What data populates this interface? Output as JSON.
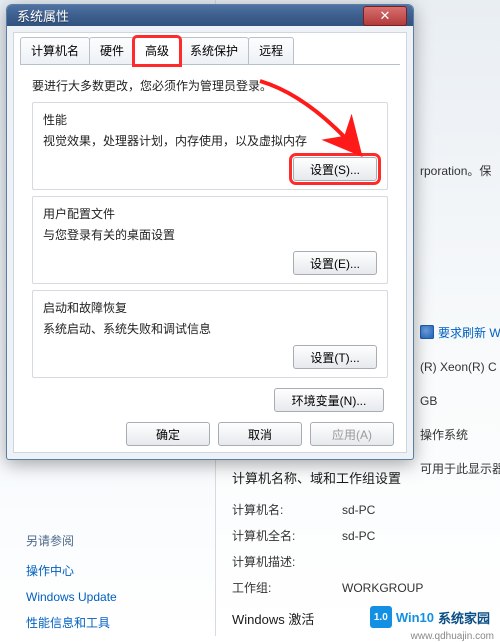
{
  "dialog": {
    "title": "系统属性",
    "close_glyph": "✕",
    "tabs": [
      {
        "label": "计算机名"
      },
      {
        "label": "硬件"
      },
      {
        "label": "高级"
      },
      {
        "label": "系统保护"
      },
      {
        "label": "远程"
      }
    ],
    "active_tab": 2,
    "admin_note": "要进行大多数更改，您必须作为管理员登录。",
    "groups": {
      "perf": {
        "title": "性能",
        "desc": "视觉效果，处理器计划，内存使用，以及虚拟内存",
        "btn": "设置(S)..."
      },
      "profile": {
        "title": "用户配置文件",
        "desc": "与您登录有关的桌面设置",
        "btn": "设置(E)..."
      },
      "startup": {
        "title": "启动和故障恢复",
        "desc": "系统启动、系统失败和调试信息",
        "btn": "设置(T)..."
      }
    },
    "env_btn": "环境变量(N)...",
    "ok": "确定",
    "cancel": "取消",
    "apply": "应用(A)"
  },
  "right": {
    "corp": "rporation。保",
    "refresh": "要求刷新 W",
    "cpu": "(R) Xeon(R) C",
    "ram": "GB",
    "os": "操作系统",
    "display": "可用于此显示器"
  },
  "center": {
    "heading": "计算机名称、域和工作组设置",
    "rows": [
      {
        "k": "计算机名:",
        "v": "sd-PC"
      },
      {
        "k": "计算机全名:",
        "v": "sd-PC"
      },
      {
        "k": "计算机描述:",
        "v": ""
      },
      {
        "k": "工作组:",
        "v": "WORKGROUP"
      }
    ],
    "activation": "Windows 激活"
  },
  "left": {
    "heading": "另请参阅",
    "links": [
      "操作中心",
      "Windows Update",
      "性能信息和工具"
    ]
  },
  "watermark": {
    "logo": "1.0",
    "brand1": "Win10",
    "brand2": "系统家园",
    "sub": "www.qdhuajin.com"
  }
}
